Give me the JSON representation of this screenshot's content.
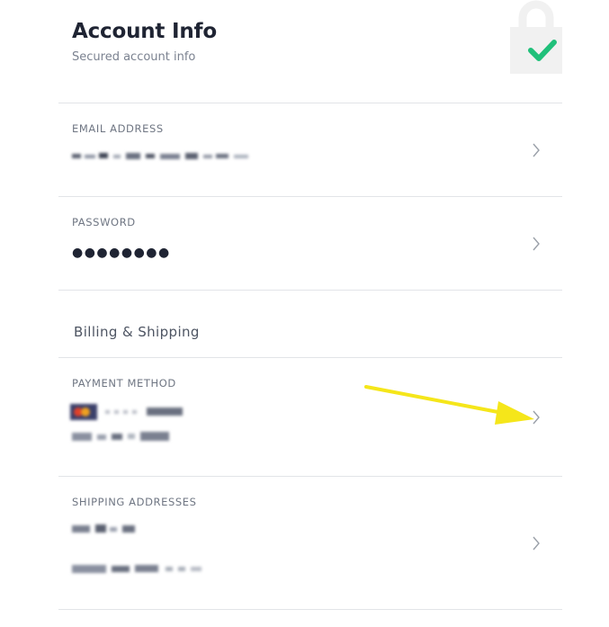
{
  "header": {
    "title": "Account Info",
    "subtitle": "Secured account info",
    "lock_icon": "padlock-check-icon",
    "check_color": "#20c07a"
  },
  "rows": {
    "email": {
      "label": "EMAIL ADDRESS",
      "value_redacted": true
    },
    "password": {
      "label": "PASSWORD",
      "value": "●●●●●●●●"
    },
    "billing_section": {
      "title": "Billing & Shipping"
    },
    "payment": {
      "label": "PAYMENT METHOD",
      "value_redacted": true
    },
    "shipping": {
      "label": "SHIPPING ADDRESSES",
      "value_redacted": true
    }
  },
  "annotation": {
    "arrow_color": "#f5e61a",
    "points_to": "payment-method-chevron"
  },
  "colors": {
    "text": "#1f2433",
    "muted": "#7b8290",
    "divider": "#e2e4e8",
    "chevron": "#9aa0a9"
  }
}
